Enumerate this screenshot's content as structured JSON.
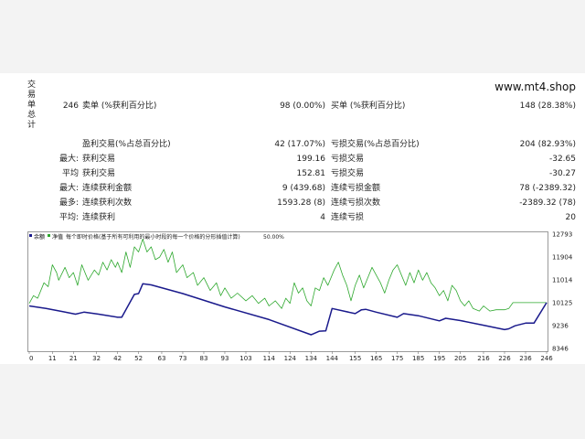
{
  "site": "www.mt4.shop",
  "section_label": "交易单总计",
  "summary": {
    "total_trades": "246",
    "short_label": "卖单 (%获利百分比)",
    "short_value": "98 (0.00%)",
    "long_label": "买单 (%获利百分比)",
    "long_value": "148 (28.38%)"
  },
  "stats": [
    {
      "lead": "",
      "l_label": "盈利交易(%占总百分比)",
      "l_value": "42 (17.07%)",
      "r_label": "亏损交易(%占总百分比)",
      "r_value": "204 (82.93%)"
    },
    {
      "lead": "最大:",
      "l_label": "获利交易",
      "l_value": "199.16",
      "r_label": "亏损交易",
      "r_value": "-32.65"
    },
    {
      "lead": "平均",
      "l_label": "获利交易",
      "l_value": "152.81",
      "r_label": "亏损交易",
      "r_value": "-30.27"
    },
    {
      "lead": "最大:",
      "l_label": "连续获利金额",
      "l_value": "9 (439.68)",
      "r_label": "连续亏损金额",
      "r_value": "78 (-2389.32)"
    },
    {
      "lead": "最多:",
      "l_label": "连续获利次数",
      "l_value": "1593.28 (8)",
      "r_label": "连续亏损次数",
      "r_value": "-2389.32 (78)"
    },
    {
      "lead": "平均:",
      "l_label": "连续获利",
      "l_value": "4",
      "r_label": "连续亏损",
      "r_value": "20"
    }
  ],
  "chart_header": {
    "balance_label": "余额",
    "equity_label": "净值",
    "desc": "每个即时价格(基于所有可利用的最小时段的每一个价格的分形插值计算)",
    "quality": "50.00%"
  },
  "colors": {
    "balance": "#1a1a8c",
    "equity": "#2ea82e",
    "legend_blue": "#1a1a8c",
    "legend_green": "#2ea82e"
  },
  "chart_data": {
    "type": "line",
    "xlabel": "",
    "ylabel": "",
    "x_ticks": [
      0,
      11,
      21,
      32,
      42,
      52,
      63,
      73,
      83,
      93,
      103,
      114,
      124,
      134,
      144,
      155,
      165,
      175,
      185,
      195,
      205,
      216,
      226,
      236,
      246
    ],
    "y_ticks": [
      12793,
      11904,
      11014,
      10125,
      9236,
      8346
    ],
    "xlim": [
      0,
      246
    ],
    "ylim": [
      8346,
      12793
    ],
    "series": [
      {
        "values": [
          [
            0,
            10000
          ],
          [
            8,
            9900
          ],
          [
            16,
            9780
          ],
          [
            22,
            9680
          ],
          [
            26,
            9760
          ],
          [
            33,
            9680
          ],
          [
            42,
            9560
          ],
          [
            44,
            9560
          ],
          [
            50,
            10450
          ],
          [
            52,
            10480
          ],
          [
            54,
            10860
          ],
          [
            58,
            10820
          ],
          [
            73,
            10480
          ],
          [
            93,
            9960
          ],
          [
            114,
            9470
          ],
          [
            134,
            8880
          ],
          [
            135,
            8910
          ],
          [
            138,
            9020
          ],
          [
            141,
            9030
          ],
          [
            144,
            9900
          ],
          [
            155,
            9700
          ],
          [
            158,
            9850
          ],
          [
            160,
            9870
          ],
          [
            165,
            9760
          ],
          [
            175,
            9560
          ],
          [
            178,
            9700
          ],
          [
            185,
            9620
          ],
          [
            195,
            9420
          ],
          [
            198,
            9520
          ],
          [
            205,
            9430
          ],
          [
            216,
            9250
          ],
          [
            226,
            9080
          ],
          [
            228,
            9110
          ],
          [
            231,
            9230
          ],
          [
            236,
            9330
          ],
          [
            240,
            9330
          ],
          [
            246,
            10130
          ]
        ]
      },
      {
        "values": [
          [
            0,
            10100
          ],
          [
            2,
            10400
          ],
          [
            4,
            10300
          ],
          [
            7,
            10900
          ],
          [
            9,
            10750
          ],
          [
            11,
            11600
          ],
          [
            13,
            11300
          ],
          [
            14,
            11000
          ],
          [
            17,
            11500
          ],
          [
            19,
            11100
          ],
          [
            21,
            11300
          ],
          [
            23,
            10800
          ],
          [
            25,
            11600
          ],
          [
            27,
            11200
          ],
          [
            28,
            11000
          ],
          [
            31,
            11400
          ],
          [
            33,
            11200
          ],
          [
            35,
            11700
          ],
          [
            37,
            11400
          ],
          [
            39,
            11800
          ],
          [
            41,
            11500
          ],
          [
            42,
            11700
          ],
          [
            44,
            11300
          ],
          [
            46,
            12100
          ],
          [
            48,
            11500
          ],
          [
            50,
            12300
          ],
          [
            52,
            12100
          ],
          [
            54,
            12600
          ],
          [
            56,
            12100
          ],
          [
            58,
            12300
          ],
          [
            60,
            11800
          ],
          [
            62,
            11900
          ],
          [
            64,
            12200
          ],
          [
            66,
            11700
          ],
          [
            68,
            12100
          ],
          [
            70,
            11300
          ],
          [
            73,
            11600
          ],
          [
            75,
            11100
          ],
          [
            78,
            11300
          ],
          [
            80,
            10800
          ],
          [
            83,
            11100
          ],
          [
            86,
            10600
          ],
          [
            89,
            10900
          ],
          [
            91,
            10400
          ],
          [
            93,
            10700
          ],
          [
            96,
            10300
          ],
          [
            99,
            10500
          ],
          [
            103,
            10200
          ],
          [
            106,
            10400
          ],
          [
            109,
            10100
          ],
          [
            112,
            10300
          ],
          [
            114,
            10000
          ],
          [
            117,
            10200
          ],
          [
            120,
            9900
          ],
          [
            122,
            10300
          ],
          [
            124,
            10100
          ],
          [
            126,
            10900
          ],
          [
            128,
            10500
          ],
          [
            130,
            10700
          ],
          [
            132,
            10200
          ],
          [
            134,
            10000
          ],
          [
            136,
            10700
          ],
          [
            138,
            10600
          ],
          [
            140,
            11100
          ],
          [
            142,
            10800
          ],
          [
            145,
            11400
          ],
          [
            147,
            11700
          ],
          [
            149,
            11200
          ],
          [
            151,
            10800
          ],
          [
            153,
            10200
          ],
          [
            155,
            10800
          ],
          [
            157,
            11200
          ],
          [
            159,
            10700
          ],
          [
            161,
            11100
          ],
          [
            163,
            11500
          ],
          [
            165,
            11200
          ],
          [
            167,
            10900
          ],
          [
            169,
            10500
          ],
          [
            171,
            11000
          ],
          [
            173,
            11400
          ],
          [
            175,
            11600
          ],
          [
            177,
            11200
          ],
          [
            179,
            10800
          ],
          [
            181,
            11300
          ],
          [
            183,
            10900
          ],
          [
            185,
            11400
          ],
          [
            187,
            11000
          ],
          [
            189,
            11300
          ],
          [
            191,
            10900
          ],
          [
            193,
            10700
          ],
          [
            195,
            10400
          ],
          [
            197,
            10600
          ],
          [
            199,
            10200
          ],
          [
            201,
            10800
          ],
          [
            203,
            10600
          ],
          [
            205,
            10200
          ],
          [
            207,
            10000
          ],
          [
            209,
            10200
          ],
          [
            211,
            9900
          ],
          [
            214,
            9800
          ],
          [
            216,
            10000
          ],
          [
            219,
            9800
          ],
          [
            222,
            9850
          ],
          [
            226,
            9850
          ],
          [
            228,
            9900
          ],
          [
            230,
            10130
          ],
          [
            246,
            10130
          ]
        ]
      }
    ]
  }
}
